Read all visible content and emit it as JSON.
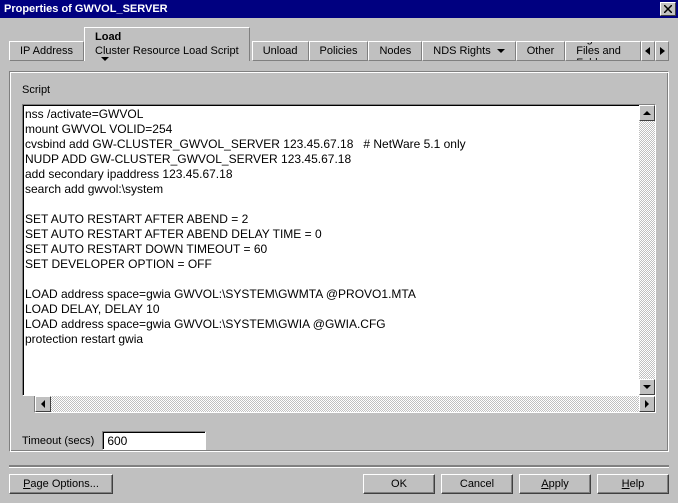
{
  "window": {
    "title": "Properties of GWVOL_SERVER"
  },
  "tabs": {
    "ip": "IP Address",
    "load": "Load",
    "load_sub": "Cluster Resource Load Script",
    "unload": "Unload",
    "policies": "Policies",
    "nodes": "Nodes",
    "nds": "NDS Rights",
    "other": "Other",
    "rtf": "Rights to Files and Fold"
  },
  "panel": {
    "script_label": "Script",
    "script_text": "nss /activate=GWVOL\nmount GWVOL VOLID=254\ncvsbind add GW-CLUSTER_GWVOL_SERVER 123.45.67.18   # NetWare 5.1 only\nNUDP ADD GW-CLUSTER_GWVOL_SERVER 123.45.67.18\nadd secondary ipaddress 123.45.67.18\nsearch add gwvol:\\system\n\nSET AUTO RESTART AFTER ABEND = 2\nSET AUTO RESTART AFTER ABEND DELAY TIME = 0\nSET AUTO RESTART DOWN TIMEOUT = 60\nSET DEVELOPER OPTION = OFF\n\nLOAD address space=gwia GWVOL:\\SYSTEM\\GWMTA @PROVO1.MTA\nLOAD DELAY, DELAY 10\nLOAD address space=gwia GWVOL:\\SYSTEM\\GWIA @GWIA.CFG\nprotection restart gwia",
    "timeout_label": "Timeout (secs)",
    "timeout_value": "600"
  },
  "buttons": {
    "page_options": "Page Options...",
    "ok": "OK",
    "cancel": "Cancel",
    "apply": "Apply",
    "help": "Help"
  }
}
